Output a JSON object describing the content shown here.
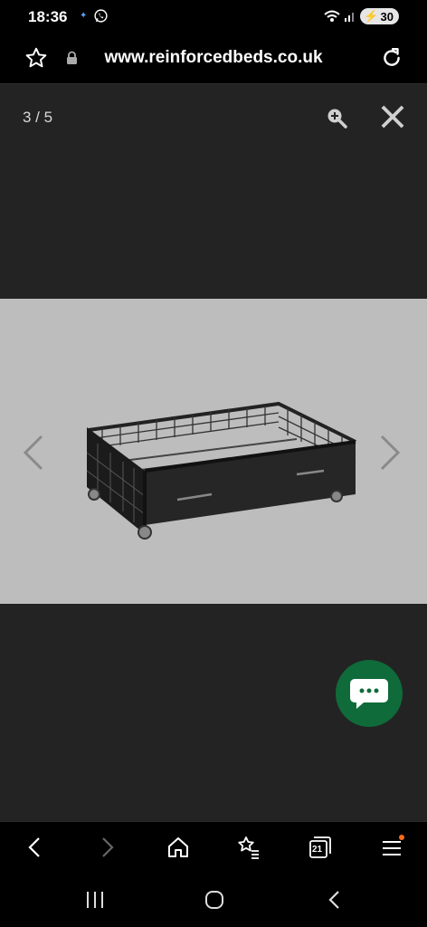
{
  "status": {
    "time": "18:36",
    "battery": "30"
  },
  "browser": {
    "url": "www.reinforcedbeds.co.uk"
  },
  "gallery": {
    "counter": "3 / 5"
  },
  "tabs": {
    "count": "21"
  },
  "colors": {
    "background": "#232323",
    "photo_bg": "#bdbdbd",
    "chat_button": "#0f6b3a",
    "menu_badge": "#ff6a1a"
  }
}
